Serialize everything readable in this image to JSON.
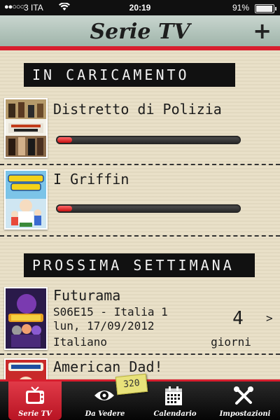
{
  "status_bar": {
    "signal": "●●○○○",
    "carrier": "3 ITA",
    "time": "20:19",
    "battery": "91%"
  },
  "header": {
    "title": "Serie TV",
    "add_label": "+"
  },
  "sections": [
    {
      "title": "IN CARICAMENTO"
    },
    {
      "title": "PROSSIMA SETTIMANA"
    }
  ],
  "loading": [
    {
      "title": "Distretto di Polizia",
      "progress": 0.08
    },
    {
      "title": "I Griffin",
      "progress": 0.08
    }
  ],
  "upcoming": [
    {
      "title": "Futurama",
      "episode": "S06E15 - Italia 1",
      "date": "lun, 17/09/2012",
      "language": "Italiano",
      "days": "4",
      "days_label": "giorni",
      "chevron": ">"
    },
    {
      "title": "American Dad!"
    }
  ],
  "tabs": [
    {
      "label": "Serie TV",
      "icon": "tv-icon"
    },
    {
      "label": "Da Vedere",
      "icon": "eye-icon"
    },
    {
      "label": "Calendario",
      "icon": "calendar-icon"
    },
    {
      "label": "Impostazioni",
      "icon": "tools-icon"
    }
  ],
  "badge": "320",
  "colors": {
    "accent": "#d81e2e",
    "paper": "#e9e0c8",
    "header_bg": "#b9c9c0"
  }
}
